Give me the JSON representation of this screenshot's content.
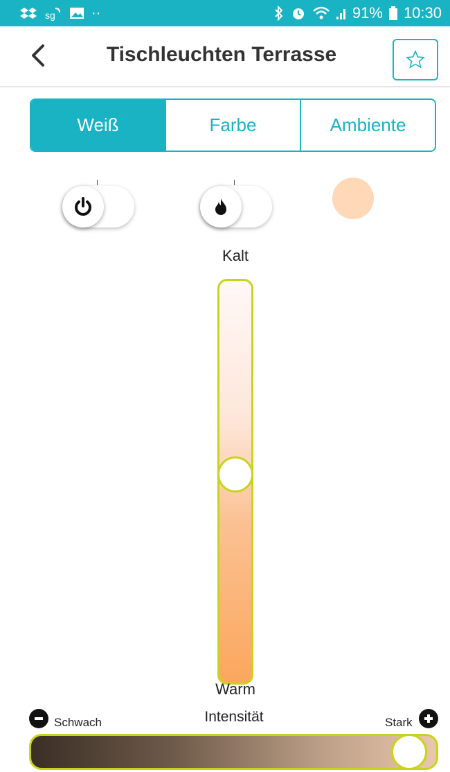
{
  "status_bar": {
    "battery": "91%",
    "time": "10:30",
    "left_icons": [
      "dropbox-icon",
      "signal-app-icon",
      "image-icon",
      "more-dots-icon"
    ],
    "right_icons": [
      "bluetooth-icon",
      "alarm-icon",
      "wifi-icon",
      "signal-icon",
      "battery-icon"
    ]
  },
  "app_bar": {
    "title": "Tischleuchten Terrasse",
    "back_icon": "chevron-left-icon",
    "favorite_icon": "star-outline-icon"
  },
  "tabs": [
    {
      "label": "Weiß",
      "active": true
    },
    {
      "label": "Farbe",
      "active": false
    },
    {
      "label": "Ambiente",
      "active": false
    }
  ],
  "controls": {
    "power_toggle_icon": "power-icon",
    "flame_toggle_icon": "flame-icon",
    "color_preview": "#ffd8b8"
  },
  "temperature_slider": {
    "top_label": "Kalt",
    "bottom_label": "Warm",
    "value_fraction_from_top": 0.48
  },
  "intensity": {
    "title": "Intensität",
    "min_label": "Schwach",
    "max_label": "Stark",
    "value_fraction": 0.97
  },
  "colors": {
    "accent": "#19b3c4",
    "slider_border": "#c8d41c"
  }
}
